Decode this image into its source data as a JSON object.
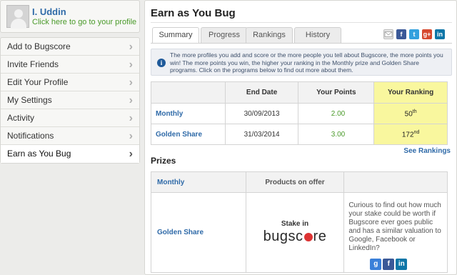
{
  "profile": {
    "name": "I. Uddin",
    "link_text": "Click here to go to your profile"
  },
  "menu": {
    "items": [
      {
        "label": "Add to Bugscore"
      },
      {
        "label": "Invite Friends"
      },
      {
        "label": "Edit Your Profile"
      },
      {
        "label": "My Settings"
      },
      {
        "label": "Activity"
      },
      {
        "label": "Notifications"
      },
      {
        "label": "Earn as You Bug",
        "active": true
      }
    ],
    "chevron": "›"
  },
  "main": {
    "title": "Earn as You Bug",
    "tabs": [
      {
        "label": "Summary",
        "active": true
      },
      {
        "label": "Progress"
      },
      {
        "label": "Rankings"
      },
      {
        "label": "History"
      }
    ],
    "social_icons": [
      "email-icon",
      "facebook-icon",
      "twitter-icon",
      "google-plus-icon",
      "linkedin-icon"
    ],
    "info_icon_glyph": "i",
    "info_text": "The more profiles you add and score or the more people you tell about Bugscore, the more points you win! The more points you win, the higher your ranking in the Monthly prize and Golden Share programs. Click on the programs below to find out more about them."
  },
  "rankings_table": {
    "headers": [
      "",
      "End Date",
      "Your Points",
      "Your Ranking"
    ],
    "rows": [
      {
        "program": "Monthly",
        "end_date": "30/09/2013",
        "points": "2.00",
        "ranking": "50",
        "ranking_suffix": "th"
      },
      {
        "program": "Golden Share",
        "end_date": "31/03/2014",
        "points": "3.00",
        "ranking": "172",
        "ranking_suffix": "nd"
      }
    ],
    "highlight_color": "#f9f79e"
  },
  "see_rankings": "See Rankings",
  "prizes": {
    "title": "Prizes",
    "header_program": "Monthly",
    "header_products": "Products on offer",
    "row_program": "Golden Share",
    "stake_label": "Stake in",
    "logo_text_left": "bugsc",
    "logo_text_right": "re",
    "curious_text": "Curious to find out how much your stake could be worth if Bugscore ever goes public and has a similar valuation to Google, Facebook or LinkedIn?",
    "share_icons": [
      "google-icon",
      "facebook-icon",
      "linkedin-icon"
    ]
  },
  "colors": {
    "link_blue": "#2f6aa8",
    "green": "#4a9a2a",
    "facebook": "#3b5998",
    "twitter": "#33a1de",
    "google_plus": "#d6492f",
    "linkedin": "#0e76a8"
  }
}
